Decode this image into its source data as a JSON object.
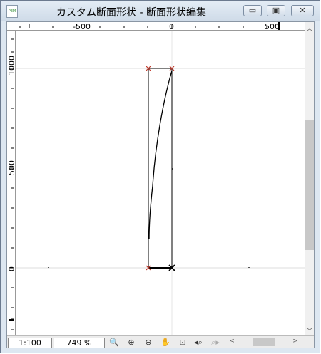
{
  "window": {
    "title": "カスタム断面形状 - 断面形状編集",
    "app_icon": "custom-profile-file-icon",
    "app_icon_text": "PEM",
    "buttons": {
      "minimize": "▭",
      "maximize": "▣",
      "close": "✕"
    }
  },
  "rulers": {
    "top_ticks": [
      "-500",
      "0",
      "500"
    ],
    "left_ticks": [
      "1000",
      "500",
      "0"
    ]
  },
  "status": {
    "scale": "1:100",
    "zoom": "749 %"
  },
  "toolbar": {
    "tools": [
      "zoom-pan-icon",
      "zoom-in-icon",
      "zoom-out-icon",
      "hand-pan-icon",
      "zoom-fit-icon",
      "zoom-previous-icon",
      "zoom-next-icon"
    ]
  },
  "colors": {
    "point_marker": "#c0392b",
    "line": "#000000",
    "grid": "#d0d0d0"
  }
}
